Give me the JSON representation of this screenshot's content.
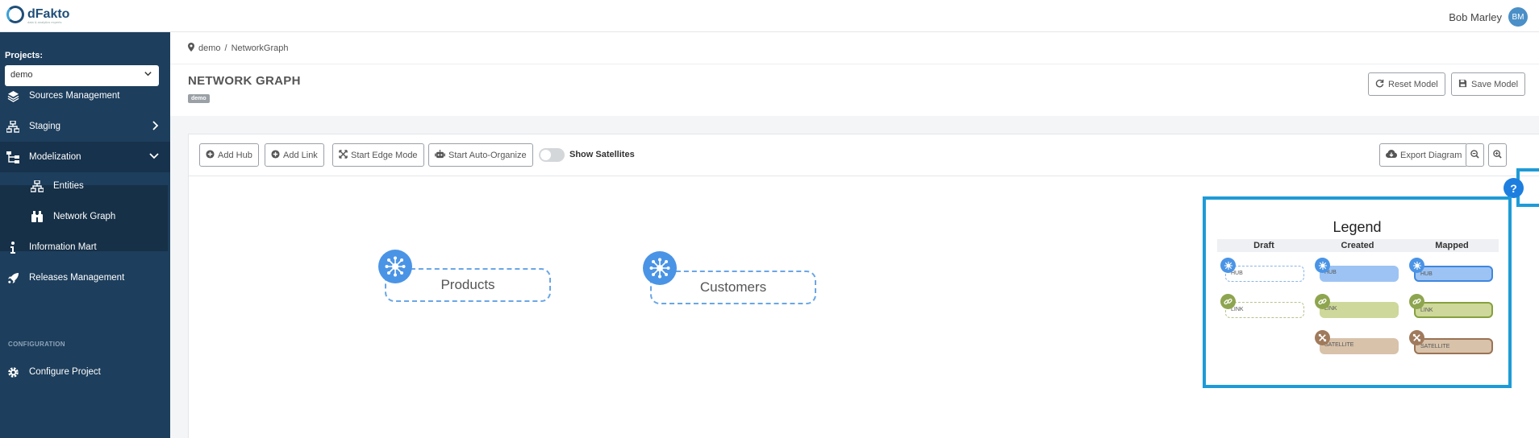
{
  "app": {
    "logo_text": "dFakto",
    "logo_sub": "data & analytics experts",
    "user_name": "Bob Marley",
    "user_initials": "BM"
  },
  "sidebar": {
    "projects_label": "Projects:",
    "project_selected": "demo",
    "items": [
      {
        "label": "Sources Management",
        "icon": "layers-icon"
      },
      {
        "label": "Staging",
        "icon": "sitemap-icon"
      },
      {
        "label": "Modelization",
        "icon": "hierarchy-icon"
      },
      {
        "label": "Information Mart",
        "icon": "info-icon"
      },
      {
        "label": "Releases Management",
        "icon": "rocket-icon"
      }
    ],
    "sub_items": [
      {
        "label": "Entities",
        "icon": "sitemap-icon"
      },
      {
        "label": "Network Graph",
        "icon": "binoculars-icon"
      }
    ],
    "config_label": "CONFIGURATION",
    "config_item": "Configure Project"
  },
  "breadcrumb": {
    "project": "demo",
    "separator": "/",
    "page": "NetworkGraph"
  },
  "header": {
    "title": "NETWORK GRAPH",
    "badge": "demo",
    "reset_label": "Reset Model",
    "save_label": "Save Model"
  },
  "toolbar": {
    "add_hub": "Add Hub",
    "add_link": "Add Link",
    "edge_mode": "Start Edge Mode",
    "auto_organize": "Start Auto-Organize",
    "show_satellites": "Show Satellites",
    "show_satellites_on": false,
    "export": "Export Diagram"
  },
  "graph": {
    "nodes": [
      {
        "label": "Products",
        "type": "hub",
        "state": "draft"
      },
      {
        "label": "Customers",
        "type": "hub",
        "state": "draft"
      }
    ]
  },
  "legend": {
    "title": "Legend",
    "columns": [
      "Draft",
      "Created",
      "Mapped"
    ],
    "hub": "HUB",
    "link": "LINK",
    "satellite": "SATELLITE",
    "help": "?"
  },
  "colors": {
    "sidebar": "#1d3e5c",
    "hub": "#4a94e6",
    "link": "#8ea54f",
    "satellite": "#a07a5c",
    "accent": "#1e9bd7"
  }
}
